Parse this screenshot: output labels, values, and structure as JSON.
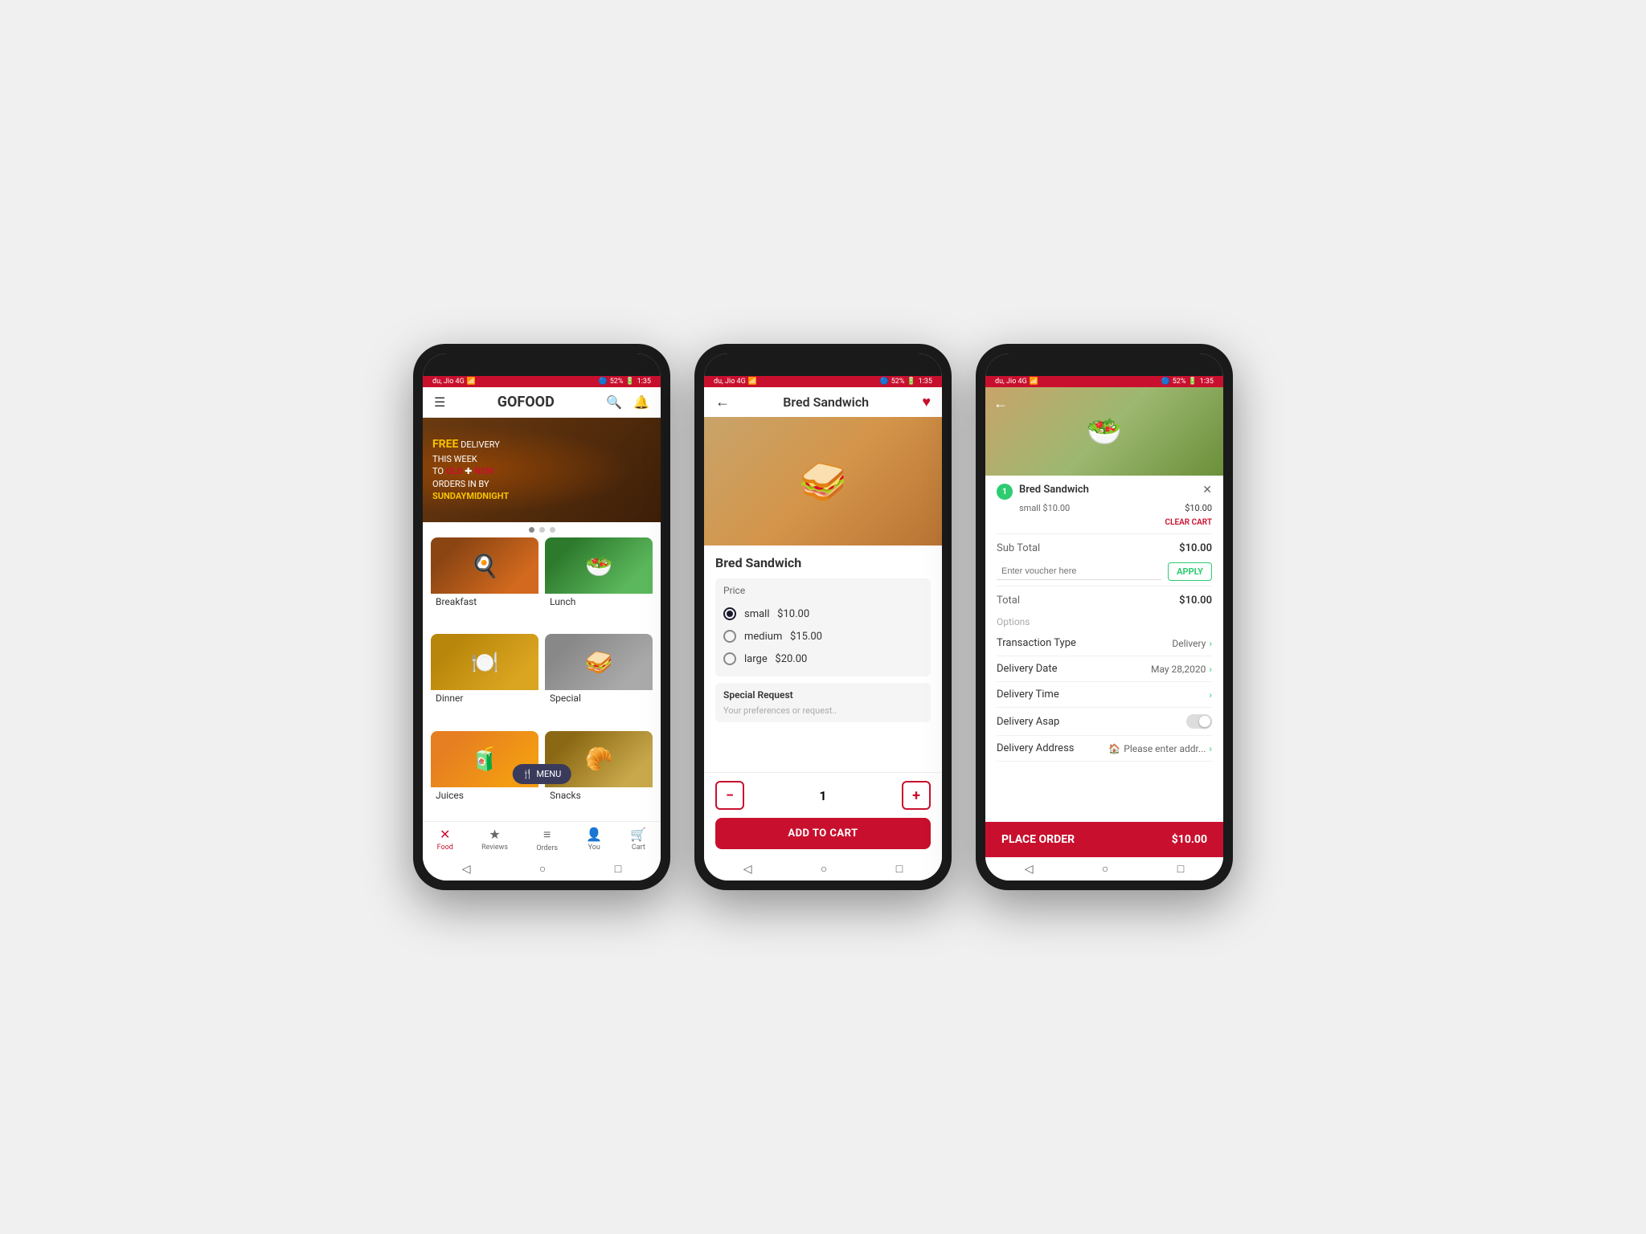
{
  "app": {
    "name": "GOFOOD",
    "statusBar": {
      "carrier": "du, Jio 4G",
      "signal": "4G",
      "battery": "52%",
      "time": "1:35"
    }
  },
  "phone1": {
    "header": {
      "menu_icon": "hamburger-icon",
      "title": "GOFOOD",
      "search_icon": "search-icon",
      "bell_icon": "bell-icon"
    },
    "banner": {
      "free_label": "FREE",
      "delivery_text": "DELIVERY",
      "this_week_text": "THIS WEEK",
      "to_text": "TO",
      "old_text": "OLD",
      "nsw_text": "NSW",
      "orders_text": "ORDERS IN BY",
      "deadline_text": "SUNDAYMIDNIGHT"
    },
    "categories": [
      {
        "id": "breakfast",
        "label": "Breakfast",
        "emoji": "🍳"
      },
      {
        "id": "lunch",
        "label": "Lunch",
        "emoji": "🥗"
      },
      {
        "id": "dinner",
        "label": "Dinner",
        "emoji": "🍽️"
      },
      {
        "id": "special",
        "label": "Special",
        "emoji": "🥪"
      },
      {
        "id": "juices",
        "label": "Juices",
        "emoji": "🧃"
      },
      {
        "id": "snacks",
        "label": "Snacks",
        "emoji": "🥐"
      }
    ],
    "menu_fab_label": "MENU",
    "bottom_nav": [
      {
        "id": "food",
        "label": "Food",
        "icon": "✕",
        "active": true
      },
      {
        "id": "reviews",
        "label": "Reviews",
        "icon": "★"
      },
      {
        "id": "orders",
        "label": "Orders",
        "icon": "≡"
      },
      {
        "id": "you",
        "label": "You",
        "icon": "👤"
      },
      {
        "id": "cart",
        "label": "Cart",
        "icon": "🛒"
      }
    ]
  },
  "phone2": {
    "header": {
      "back_icon": "back-arrow-icon",
      "title": "Bred Sandwich",
      "heart_icon": "heart-icon"
    },
    "product": {
      "name": "Bred Sandwich",
      "price_label": "Price",
      "options": [
        {
          "id": "small",
          "label": "small",
          "price": "$10.00",
          "selected": true
        },
        {
          "id": "medium",
          "label": "medium",
          "price": "$15.00",
          "selected": false
        },
        {
          "id": "large",
          "label": "large",
          "price": "$20.00",
          "selected": false
        }
      ],
      "special_request_label": "Special Request",
      "special_request_placeholder": "Your preferences or request..",
      "quantity": "1",
      "add_to_cart_label": "ADD TO CART"
    }
  },
  "phone3": {
    "back_icon": "back-arrow-icon",
    "cart": {
      "item_count": "1",
      "item_name": "Bred Sandwich",
      "item_size": "small $10.00",
      "item_price": "$10.00",
      "clear_cart_label": "CLEAR CART",
      "sub_total_label": "Sub Total",
      "sub_total_value": "$10.00",
      "voucher_placeholder": "Enter voucher here",
      "apply_label": "APPLY",
      "total_label": "Total",
      "total_value": "$10.00",
      "options_label": "Options",
      "transaction_type_label": "Transaction Type",
      "transaction_type_value": "Delivery",
      "delivery_date_label": "Delivery Date",
      "delivery_date_value": "May 28,2020",
      "delivery_time_label": "Delivery Time",
      "delivery_asap_label": "Delivery Asap",
      "delivery_address_label": "Delivery Address",
      "delivery_address_value": "Please enter addr...",
      "place_order_label": "PLACE ORDER",
      "place_order_price": "$10.00"
    }
  }
}
